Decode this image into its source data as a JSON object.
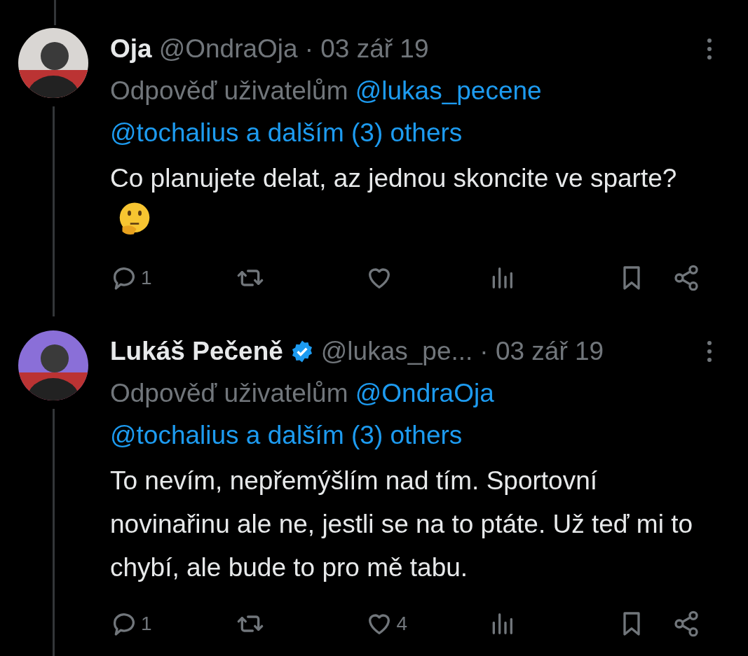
{
  "tweets": [
    {
      "name": "Oja",
      "verified": false,
      "handle": "@OndraOja",
      "date": "· 03 zář 19",
      "reply_prefix": "Odpověď uživatelům",
      "mentions": [
        "@lukas_pecene",
        "@tochalius a dalším (3) others"
      ],
      "text": "Co planujete delat, az jednou skoncite ve sparte?",
      "thinking_emoji": true,
      "actions": [
        {
          "kind": "reply",
          "count": "1"
        },
        {
          "kind": "repost"
        },
        {
          "kind": "like"
        },
        {
          "kind": "views"
        },
        {
          "kind": "bookmark"
        },
        {
          "kind": "share"
        }
      ]
    },
    {
      "name": "Lukáš Pečeně",
      "verified": true,
      "handle": "@lukas_pe...",
      "date": "· 03 zář 19",
      "reply_prefix": "Odpověď uživatelům",
      "mentions": [
        "@OndraOja",
        "@tochalius a dalším (3) others"
      ],
      "text": "To nevím, nepřemýšlím nad tím. Sportovní novinařinu ale ne, jestli se na to ptáte. Už teď mi to chybí, ale bude to pro mě tabu.",
      "actions": [
        {
          "kind": "reply",
          "count": "1"
        },
        {
          "kind": "repost"
        },
        {
          "kind": "like",
          "count": "4"
        },
        {
          "kind": "views"
        },
        {
          "kind": "bookmark"
        },
        {
          "kind": "share"
        }
      ]
    }
  ]
}
